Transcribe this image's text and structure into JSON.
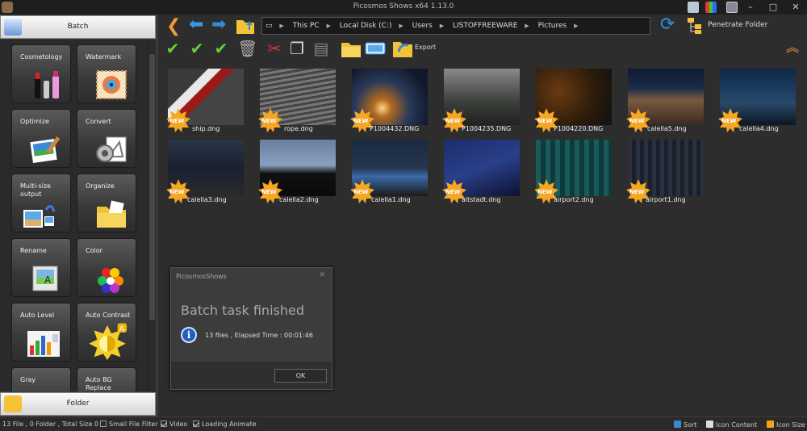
{
  "window": {
    "title": "Picosmos Shows x64 1.13.0",
    "minimize": "–",
    "maximize": "□",
    "close": "✕"
  },
  "sidebar": {
    "batch_label": "Batch",
    "folder_label": "Folder",
    "tiles": [
      {
        "label": "Cosmetology"
      },
      {
        "label": "Watermark"
      },
      {
        "label": "Optimize"
      },
      {
        "label": "Convert"
      },
      {
        "label": "Multi-size output"
      },
      {
        "label": "Organize"
      },
      {
        "label": "Rename"
      },
      {
        "label": "Color"
      },
      {
        "label": "Auto Level"
      },
      {
        "label": "Auto Contrast"
      },
      {
        "label": "Gray"
      },
      {
        "label": "Auto BG Replace"
      }
    ]
  },
  "address": {
    "segments": [
      "This PC",
      "Local Disk (C:)",
      "Users",
      "LISTOFFREEWARE",
      "Pictures"
    ]
  },
  "toolbar": {
    "penetrate_folder": "Penetrate Folder",
    "export": "Export"
  },
  "badge": {
    "text": "NEW",
    "color": "#f5a623"
  },
  "files": [
    {
      "name": "ship.dng"
    },
    {
      "name": "rope.dng"
    },
    {
      "name": "P1004432.DNG"
    },
    {
      "name": "P1004235.DNG"
    },
    {
      "name": "P1004220.DNG"
    },
    {
      "name": "calella5.dng"
    },
    {
      "name": "calella4.dng"
    },
    {
      "name": "calella3.dng"
    },
    {
      "name": "calella2.dng"
    },
    {
      "name": "calella1.dng"
    },
    {
      "name": "altstadt.dng"
    },
    {
      "name": "airport2.dng"
    },
    {
      "name": "airport1.dng"
    }
  ],
  "dialog": {
    "title": "PicosmosShows",
    "close": "✕",
    "heading": "Batch task finished",
    "info_icon_text": "i",
    "message": "13 files , Elapsed Time : 00:01:46",
    "ok_label": "OK"
  },
  "statusbar": {
    "summary": "13 File , 0 Folder , Total Size 0",
    "small_file_filter": {
      "label": "Small File Filter",
      "checked": false
    },
    "video": {
      "label": "Video",
      "checked": true
    },
    "loading_animate": {
      "label": "Loading Animate",
      "checked": true
    },
    "sort": "Sort",
    "icon_content": "Icon Content",
    "icon_size": "Icon Size"
  }
}
